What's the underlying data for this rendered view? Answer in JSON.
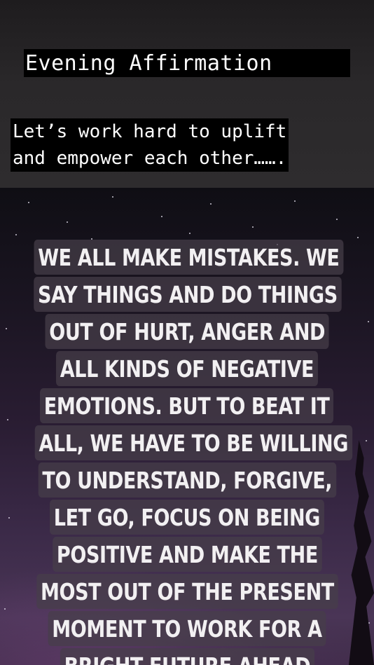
{
  "caption": {
    "title": "Evening Affirmation ",
    "subtitle_lines": [
      "Let’s work hard to uplift",
      "and empower each other……."
    ]
  },
  "quote": {
    "lines": [
      "WE ALL MAKE MISTAKES. WE",
      "SAY THINGS AND DO THINGS",
      "OUT OF HURT, ANGER AND",
      "ALL KINDS OF NEGATIVE",
      "EMOTIONS. BUT TO BEAT IT",
      "ALL, WE HAVE TO BE WILLING",
      "TO UNDERSTAND, FORGIVE,",
      "LET GO, FOCUS ON BEING",
      "POSITIVE AND MAKE THE",
      "MOST OUT OF THE PRESENT",
      "MOMENT TO WORK FOR A",
      "BRIGHT FUTURE AHEAD"
    ]
  },
  "colors": {
    "caption_bg": "#000000",
    "caption_text": "#ffffff",
    "quote_box": "#463e4a",
    "quote_text": "#f2f0f2",
    "sky_top": "#0f0e14",
    "sky_bottom": "#4a3556"
  }
}
